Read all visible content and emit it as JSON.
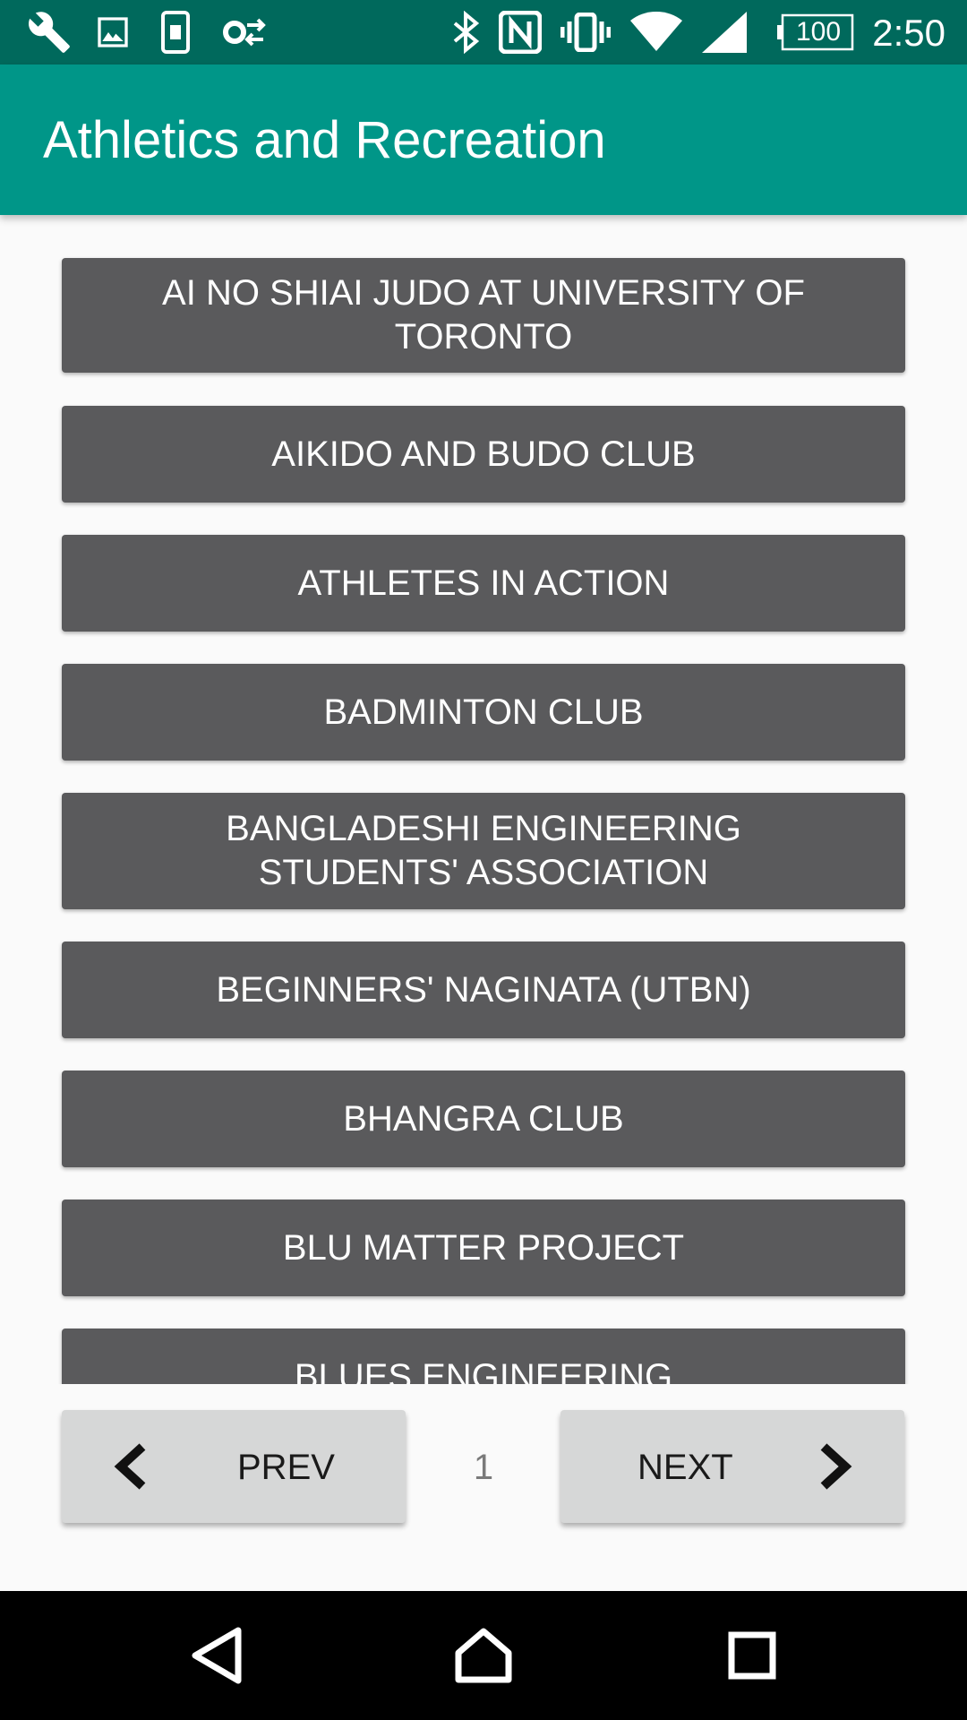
{
  "status_bar": {
    "time": "2:50",
    "battery": "100",
    "left_icons": [
      "wrench-icon",
      "image-icon",
      "sim-icon",
      "settings-sync-icon"
    ],
    "right_icons": [
      "bluetooth-icon",
      "nfc-icon",
      "vibrate-icon",
      "wifi-icon",
      "cell-signal-icon",
      "battery-icon"
    ]
  },
  "app_bar": {
    "title": "Athletics and Recreation"
  },
  "clubs": [
    "AI NO SHIAI JUDO AT UNIVERSITY OF TORONTO",
    "AIKIDO AND BUDO CLUB",
    "ATHLETES IN ACTION",
    "BADMINTON CLUB",
    "BANGLADESHI ENGINEERING STUDENTS' ASSOCIATION",
    "BEGINNERS' NAGINATA (UTBN)",
    "BHANGRA CLUB",
    "BLU MATTER PROJECT",
    "BLUES ENGINEERING"
  ],
  "pager": {
    "prev_label": "PREV",
    "next_label": "NEXT",
    "page_number": "1"
  },
  "nav_bar": {
    "buttons": [
      "back-icon",
      "home-icon",
      "recents-icon"
    ]
  },
  "colors": {
    "status_bar": "#00695c",
    "app_bar": "#009688",
    "list_item": "#5a5a5c",
    "pager_button": "#d6d7d7",
    "background": "#fafafa"
  }
}
